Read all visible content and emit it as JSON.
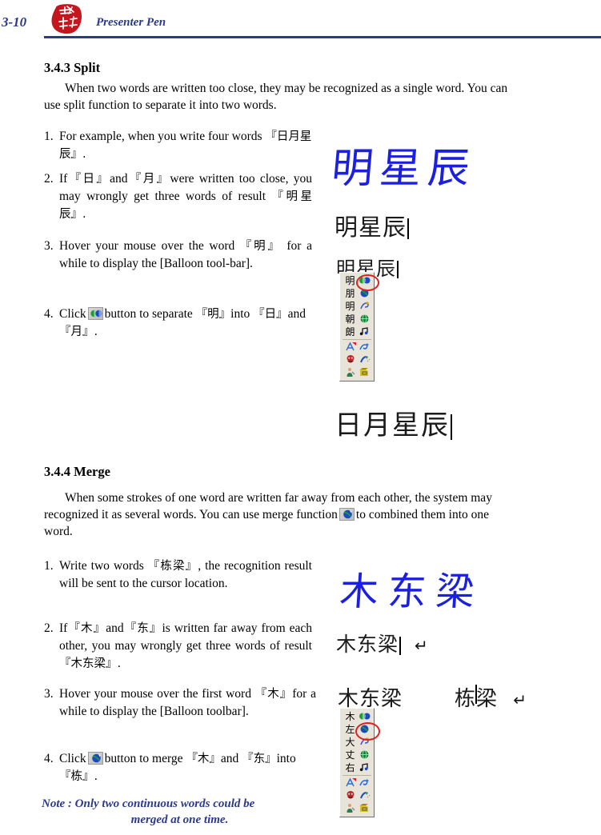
{
  "header": {
    "page_number": "3-10",
    "title": "Presenter Pen",
    "logo_name": "red-seal-logo",
    "accent_color": "#2b3a8c",
    "rule_color": "#2b3a8c",
    "logo_color": "#c4161c"
  },
  "split_section": {
    "heading": "3.4.3 Split",
    "intro_line1": "When two words are written too close, they may be recognized as a single word. You can",
    "intro_line2": "use split function to separate it into two words.",
    "items": [
      {
        "num": "1.",
        "parts": [
          {
            "t": "For example, when you write four words",
            "k": "en"
          },
          {
            "t": "『日月星辰』.",
            "k": "cjk"
          }
        ]
      },
      {
        "num": "2.",
        "parts": [
          {
            "t": "If",
            "k": "en"
          },
          {
            "t": "『日』",
            "k": "cjk"
          },
          {
            "t": "and",
            "k": "en"
          },
          {
            "t": "『月』",
            "k": "cjk"
          },
          {
            "t": "were written too close, you may wrongly get three words of result",
            "k": "en"
          },
          {
            "t": "『明星辰』.",
            "k": "cjk"
          }
        ]
      },
      {
        "num": "3.",
        "parts": [
          {
            "t": "Hover your mouse over the word",
            "k": "en"
          },
          {
            "t": "『明』",
            "k": "cjk"
          },
          {
            "t": "for a while to display the [Balloon tool-bar].",
            "k": "en"
          }
        ]
      },
      {
        "num": "4.",
        "parts": [
          {
            "t": "Click",
            "k": "en"
          },
          {
            "t": "split-button-icon",
            "k": "icon"
          },
          {
            "t": "button to separate",
            "k": "en"
          },
          {
            "t": "『明』",
            "k": "cjk"
          },
          {
            "t": "into",
            "k": "en"
          },
          {
            "t": "『日』",
            "k": "cjk"
          },
          {
            "t": "and",
            "k": "en"
          },
          {
            "t": "『月』.",
            "k": "cjk"
          }
        ]
      }
    ],
    "figure": {
      "handwriting": "明星辰",
      "handwriting_color": "#1b20e0",
      "recognized_text": "明星辰",
      "tooltip_text": "明星辰",
      "final_result": "日月星辰",
      "balloon": {
        "highlighted_row": 0,
        "rows": [
          {
            "char": "明",
            "icon": "split-icon"
          },
          {
            "char": "朋",
            "icon": "merge-icon"
          },
          {
            "char": "明",
            "icon": "pen-edit-icon"
          },
          {
            "char": "朝",
            "icon": "globe-green-icon"
          },
          {
            "char": "朗",
            "icon": "music-note-icon"
          }
        ],
        "tool_rows": [
          {
            "left": "letter-a-icon",
            "right": "scribble-blue-icon"
          },
          {
            "left": "mask-red-icon",
            "right": "hand-write-icon"
          },
          {
            "left": "person-icon",
            "right": "book-icon"
          }
        ]
      }
    }
  },
  "merge_section": {
    "heading": "3.4.4 Merge",
    "intro_line1": "When some strokes of one word are written far away from each other, the system may",
    "intro_line2_a": "recognized it as several words. You can use merge function",
    "intro_icon": "merge-button-icon",
    "intro_line2_b": "to combined them into one",
    "intro_line3": "word.",
    "items": [
      {
        "num": "1.",
        "parts": [
          {
            "t": "Write two words",
            "k": "en"
          },
          {
            "t": "『栋梁』",
            "k": "cjk"
          },
          {
            "t": ", the recognition result will be sent to the cursor location.",
            "k": "en"
          }
        ]
      },
      {
        "num": "2.",
        "parts": [
          {
            "t": "If",
            "k": "en"
          },
          {
            "t": "『木』",
            "k": "cjk"
          },
          {
            "t": "and",
            "k": "en"
          },
          {
            "t": "『东』",
            "k": "cjk"
          },
          {
            "t": "is written far away from each other, you may wrongly get three words of result",
            "k": "en"
          },
          {
            "t": "『木东梁』.",
            "k": "cjk"
          }
        ]
      },
      {
        "num": "3.",
        "parts": [
          {
            "t": "Hover your mouse over the first word",
            "k": "en"
          },
          {
            "t": "『木』",
            "k": "cjk"
          },
          {
            "t": "for a while to display the [Balloon toolbar].",
            "k": "en"
          }
        ]
      },
      {
        "num": "4.",
        "parts": [
          {
            "t": "Click",
            "k": "en"
          },
          {
            "t": "merge-button-icon",
            "k": "icon"
          },
          {
            "t": "button to merge",
            "k": "en"
          },
          {
            "t": "『木』",
            "k": "cjk"
          },
          {
            "t": "and",
            "k": "en"
          },
          {
            "t": "『东』",
            "k": "cjk"
          },
          {
            "t": "into",
            "k": "en"
          },
          {
            "t": "『栋』.",
            "k": "cjk"
          }
        ]
      }
    ],
    "note_line1": "Note : Only two continuous words could be",
    "note_line2": "merged at one time.",
    "note_color": "#2b3a8c",
    "figure": {
      "handwriting": "木东梁",
      "handwriting_color": "#1b20e0",
      "recognized_text": "木东梁",
      "recognized_mark": "↵",
      "tooltip_text": "木东梁",
      "final_result": "栋梁",
      "final_mark": "↵",
      "balloon": {
        "highlighted_row": 1,
        "rows": [
          {
            "char": "木",
            "icon": "split-icon"
          },
          {
            "char": "左",
            "icon": "merge-icon"
          },
          {
            "char": "大",
            "icon": "pen-edit-icon"
          },
          {
            "char": "丈",
            "icon": "globe-green-icon"
          },
          {
            "char": "右",
            "icon": "music-note-icon"
          }
        ],
        "tool_rows": [
          {
            "left": "letter-a-icon",
            "right": "scribble-blue-icon"
          },
          {
            "left": "mask-red-icon",
            "right": "hand-write-icon"
          },
          {
            "left": "person-icon",
            "right": "book-icon"
          }
        ]
      }
    }
  }
}
